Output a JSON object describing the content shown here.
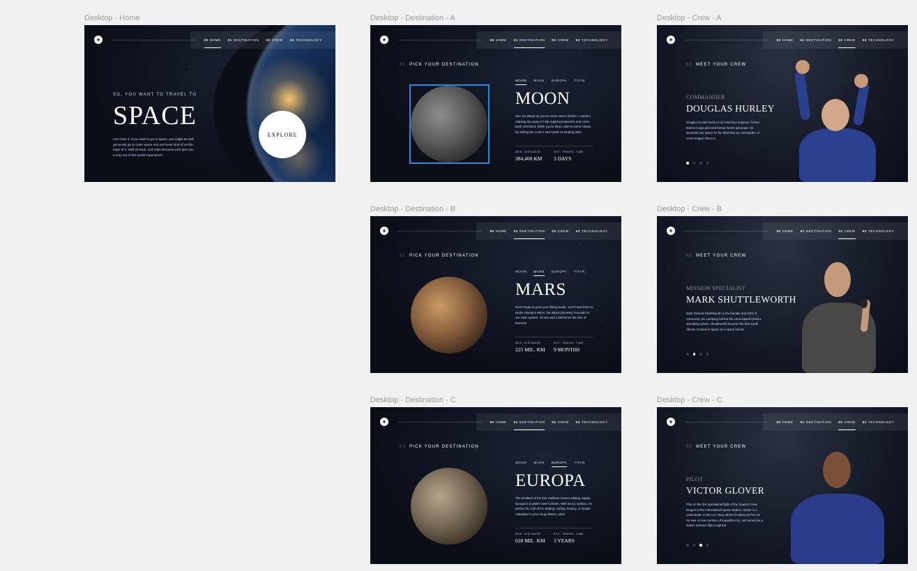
{
  "frames": {
    "home": {
      "label": "Desktop - Home",
      "nav": [
        "00",
        "HOME",
        "01",
        "DESTINATION",
        "02",
        "CREW",
        "03",
        "TECHNOLOGY"
      ],
      "subtitle": "SO, YOU WANT TO TRAVEL TO",
      "title": "SPACE",
      "body": "Let's face it; if you want to go to space, you might as well genuinely go to outer space and not hover kind of on the edge of it. Well sit back, and relax because we'll give you a truly out of this world experience!",
      "explore": "EXPLORE"
    },
    "dest_a": {
      "label": "Desktop - Destination - A",
      "eyebrow_num": "01",
      "eyebrow": "PICK YOUR DESTINATION",
      "tabs": [
        "MOON",
        "MARS",
        "EUROPA",
        "TITAN"
      ],
      "name": "MOON",
      "desc": "See our planet as you've never seen it before. A perfect relaxing trip away to help regain perspective and come back refreshed. While you're there, take in some history by visiting the Luna 2 and Apollo 11 landing sites.",
      "dist_label": "AVG. DISTANCE",
      "dist": "384,400 KM",
      "time_label": "EST. TRAVEL TIME",
      "time": "3 DAYS"
    },
    "dest_b": {
      "label": "Desktop - Destination - B",
      "eyebrow_num": "01",
      "eyebrow": "PICK YOUR DESTINATION",
      "tabs": [
        "MOON",
        "MARS",
        "EUROPA",
        "TITAN"
      ],
      "name": "MARS",
      "desc": "Don't forget to pack your hiking boots. You'll need them to tackle Olympus Mons, the tallest planetary mountain in our solar system. It's two and a half times the size of Everest!",
      "dist_label": "AVG. DISTANCE",
      "dist": "225 MIL. KM",
      "time_label": "EST. TRAVEL TIME",
      "time": "9 MONTHS"
    },
    "dest_c": {
      "label": "Desktop - Destination - C",
      "eyebrow_num": "01",
      "eyebrow": "PICK YOUR DESTINATION",
      "tabs": [
        "MOON",
        "MARS",
        "EUROPA",
        "TITAN"
      ],
      "name": "EUROPA",
      "desc": "The smallest of the four Galilean moons orbiting Jupiter, Europa is a winter lover's dream. With an icy surface, it's perfect for a bit of ice skating, curling, hockey, or simple relaxation in your snug wintery cabin.",
      "dist_label": "AVG. DISTANCE",
      "dist": "628 MIL. KM",
      "time_label": "EST. TRAVEL TIME",
      "time": "3 YEARS"
    },
    "crew_a": {
      "label": "Desktop - Crew - A",
      "eyebrow_num": "02",
      "eyebrow": "MEET YOUR CREW",
      "role": "COMMANDER",
      "name": "DOUGLAS HURLEY",
      "bio": "Douglas Gerald Hurley is an American engineer, former Marine Corps pilot and former NASA astronaut. He launched into space for the third time as commander of Crew Dragon Demo-2."
    },
    "crew_b": {
      "label": "Desktop - Crew -  B",
      "eyebrow_num": "02",
      "eyebrow": "MEET YOUR CREW",
      "role": "MISSION SPECIALIST",
      "name": "MARK SHUTTLEWORTH",
      "bio": "Mark Richard Shuttleworth is the founder and CEO of Canonical, the company behind the Linux-based Ubuntu operating system. Shuttleworth became the first South African to travel to space as a space tourist."
    },
    "crew_c": {
      "label": "Desktop - Crew -  C",
      "eyebrow_num": "02",
      "eyebrow": "MEET YOUR CREW",
      "role": "PILOT",
      "name": "VICTOR GLOVER",
      "bio": "Pilot on the first operational flight of the SpaceX Crew Dragon to the International Space Station. Glover is a commander in the U.S. Navy where he pilots an F/A-18. He was a crew member of Expedition 64, and served as a station systems flight engineer."
    }
  },
  "colors": {
    "bg": "#0b0d17",
    "accent": "#d0d6f9",
    "selection": "#1f8de8",
    "canvas": "#f1f1f1"
  },
  "icons": [
    "logo-star-icon"
  ]
}
